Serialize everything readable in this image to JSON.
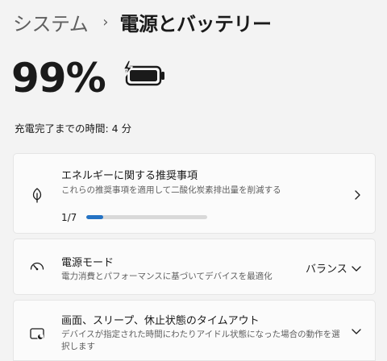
{
  "breadcrumb": {
    "parent": "システム",
    "separator": "›",
    "current": "電源とバッテリー"
  },
  "battery": {
    "percent": "99%",
    "icon": "battery-charging-icon",
    "charge_time": "充電完了までの時間: 4 分"
  },
  "energy_card": {
    "title": "エネルギーに関する推奨事項",
    "description": "これらの推奨事項を適用して二酸化炭素排出量を削減する",
    "progress_label": "1/7",
    "progress_fraction": 0.143,
    "icon": "leaf-icon",
    "chevron": "chevron-right-icon"
  },
  "power_mode_card": {
    "title": "電源モード",
    "description": "電力消費とパフォーマンスに基づいてデバイスを最適化",
    "selected_value": "バランス",
    "icon": "gauge-icon",
    "chevron": "chevron-down-icon"
  },
  "sleep_card": {
    "title": "画面、スリープ、休止状態のタイムアウト",
    "description_line1": "デバイスが指定された時間にわたりアイドル状態になった場合の動作を選",
    "description_line2": "択します",
    "icon": "screen-sleep-icon",
    "chevron": "chevron-down-icon"
  },
  "colors": {
    "accent": "#2573c4",
    "background": "#f3f3f3",
    "card": "#fbfbfb"
  }
}
